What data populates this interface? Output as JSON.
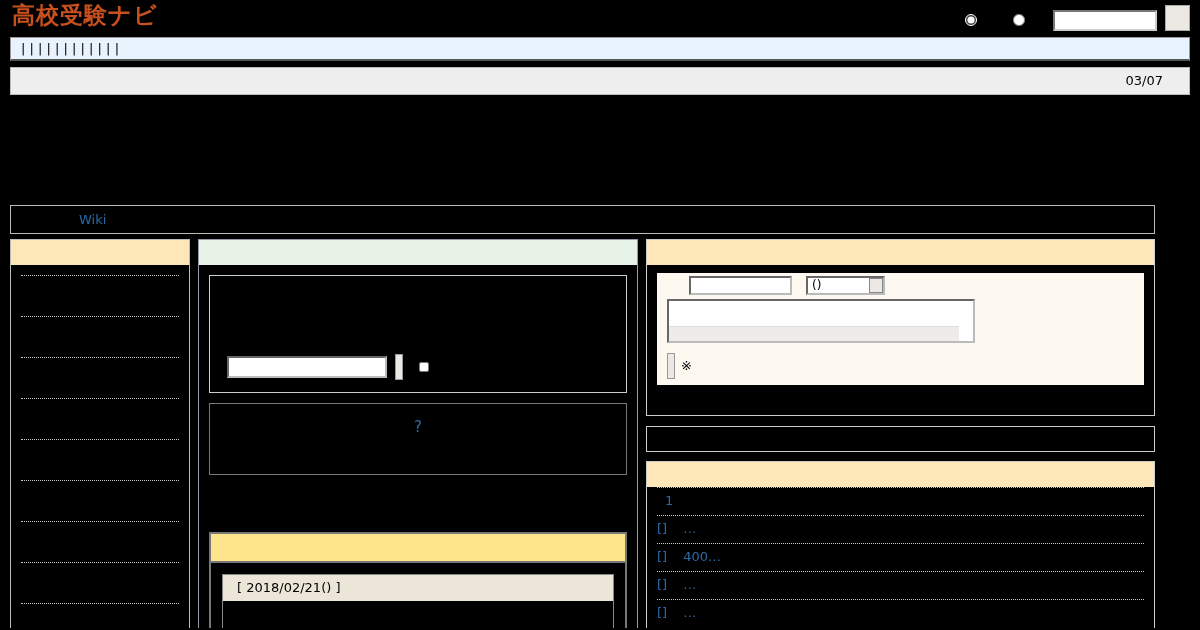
{
  "header": {
    "logo": "高校受験ナビ",
    "search_scope": [
      {
        "selected": true
      },
      {
        "selected": false
      }
    ]
  },
  "nav": {
    "text": "| | | | | | | | | | | |"
  },
  "date_bar": {
    "date": "03/07"
  },
  "breadcrumb": {
    "link": "Wiki"
  },
  "wiki_search": {
    "include_option": {
      "checked": false
    }
  },
  "help": {
    "link": "?"
  },
  "diary": {
    "entry_date": "[ 2018/02/21() ]"
  },
  "comment_form": {
    "select_value": "()",
    "note": "※"
  },
  "recent_list": [
    {
      "title": "1"
    },
    {
      "bracket": "[]",
      "title": "…"
    },
    {
      "bracket": "[]",
      "title": "400…"
    },
    {
      "bracket": "[]",
      "title": "…"
    },
    {
      "bracket": "[]",
      "title": "…"
    }
  ]
}
